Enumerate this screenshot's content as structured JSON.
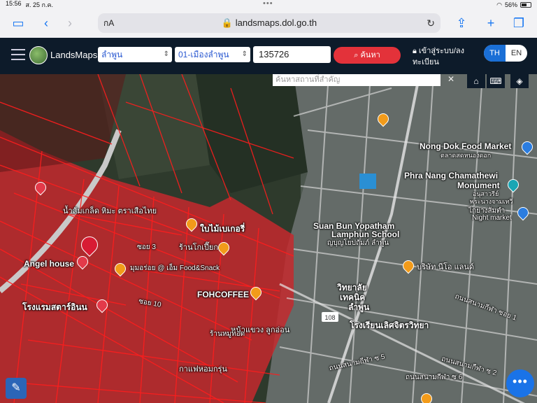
{
  "status": {
    "time": "15:56",
    "date": "ส. 25 ก.ค.",
    "battery": "56%",
    "battery_level": 0.56
  },
  "browser": {
    "url_host": "landsmaps.dol.go.th",
    "aa_label": "กA"
  },
  "header": {
    "brand": "LandsMaps",
    "province": "ลำพูน",
    "district": "01-เมืองลำพูน",
    "parcel_no": "135726",
    "search_label": "ค้นหา",
    "login_label": "เข้าสู่ระบบ/ลงทะเบียน",
    "lang": [
      "TH",
      "EN"
    ],
    "lang_active": "TH"
  },
  "map": {
    "place_search_placeholder": "ค้นหาสถานที่สำคัญ",
    "labels": [
      "Nong Dok Food Market",
      "ตลาดสดหนองดอก",
      "Phra Nang Chamathewi",
      "Monument",
      "อนุสาวรีย์",
      "พระนางจามเทวี",
      "ไก่ย่างส้มตำ",
      "Night market",
      "Suan Bun Yopatham",
      "Lamphun School",
      "ญบุญโยปถัมภ์ ลำพูน",
      "บริษัท นีโอ แลนด์",
      "วิทยาลัย",
      "เทคนิค",
      "ลำพูน",
      "ถนนสนามกีฬา ซอย 1",
      "โรงเรียนเลิศจิตรวิทยา",
      "ถนนสนามกีฬา ซ 5",
      "ถนนสนามกีฬา ซ 6",
      "ถนนสนามกีฬา ซ 2",
      "Angel house",
      "โรงแรมสตาร์อินน",
      "FOHCOFFEE",
      "น้ำส้มเกล็ด หิมะ ตราเสือไทย",
      "ใบไม้เบเกอรี่",
      "ร้านโกเปี๊ยก",
      "มุมอร่อย @ เอ็ม Food&Snack",
      "หน้าแขวง ลูกอ่อน",
      "ร้านหมูทอด",
      "กาแฟหอมกรุ่น",
      "ซอย 3",
      "ซอย 10",
      "108"
    ]
  },
  "colors": {
    "header_bg": "#0d1b2a",
    "accent_red": "#e3323a",
    "accent_blue": "#1a73e8",
    "parcel_line": "#ff1d1d"
  }
}
